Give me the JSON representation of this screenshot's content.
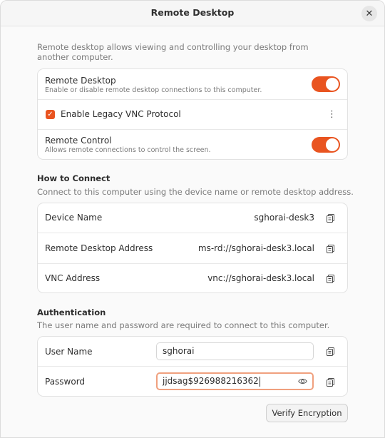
{
  "window": {
    "title": "Remote Desktop",
    "close_glyph": "✕"
  },
  "intro": "Remote desktop allows viewing and controlling your desktop from another computer.",
  "sharing": {
    "remote_desktop": {
      "title": "Remote Desktop",
      "subtitle": "Enable or disable remote desktop connections to this computer.",
      "enabled": true
    },
    "legacy_vnc": {
      "label": "Enable Legacy VNC Protocol",
      "checked": true,
      "check_glyph": "✓",
      "menu_glyph": "⋮"
    },
    "remote_control": {
      "title": "Remote Control",
      "subtitle": "Allows remote connections to control the screen.",
      "enabled": true
    }
  },
  "how_to_connect": {
    "heading": "How to Connect",
    "subtitle": "Connect to this computer using the device name or remote desktop address.",
    "rows": [
      {
        "label": "Device Name",
        "value": "sghorai-desk3",
        "icon": "copy-icon"
      },
      {
        "label": "Remote Desktop Address",
        "value": "ms-rd://sghorai-desk3.local",
        "icon": "copy-icon"
      },
      {
        "label": "VNC Address",
        "value": "vnc://sghorai-desk3.local",
        "icon": "copy-icon"
      }
    ]
  },
  "authentication": {
    "heading": "Authentication",
    "subtitle": "The user name and password are required to connect to this computer.",
    "username": {
      "label": "User Name",
      "value": "sghorai"
    },
    "password": {
      "label": "Password",
      "value": "jjdsag$926988216362"
    }
  },
  "verify_button": "Verify Encryption",
  "colors": {
    "accent": "#e95420",
    "focus_ring": "#f0a07e"
  }
}
